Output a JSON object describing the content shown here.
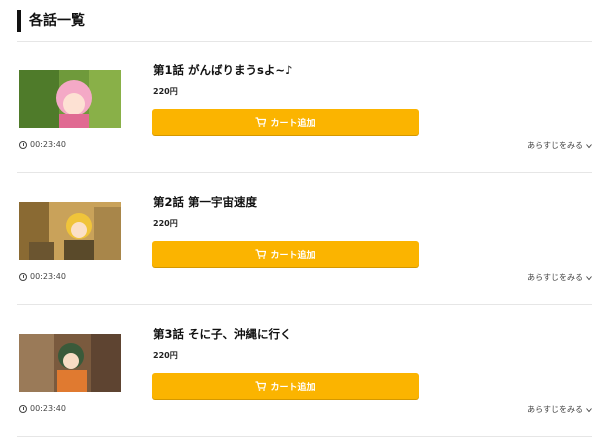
{
  "section": {
    "title": "各話一覧"
  },
  "episodes": [
    {
      "title": "第1話 がんばりまうsよ~♪",
      "price": "220円",
      "cart_label": "カート追加",
      "duration": "00:23:40",
      "synopsis_label": "あらすじをみる"
    },
    {
      "title": "第2話 第一宇宙速度",
      "price": "220円",
      "cart_label": "カート追加",
      "duration": "00:23:40",
      "synopsis_label": "あらすじをみる"
    },
    {
      "title": "第3話 そに子、沖縄に行く",
      "price": "220円",
      "cart_label": "カート追加",
      "duration": "00:23:40",
      "synopsis_label": "あらすじをみる"
    }
  ],
  "colors": {
    "accent": "#fbb400",
    "divider": "#e6e6e6",
    "text": "#222222"
  },
  "icons": [
    "cart-icon",
    "clock-icon",
    "chevron-down-icon"
  ]
}
